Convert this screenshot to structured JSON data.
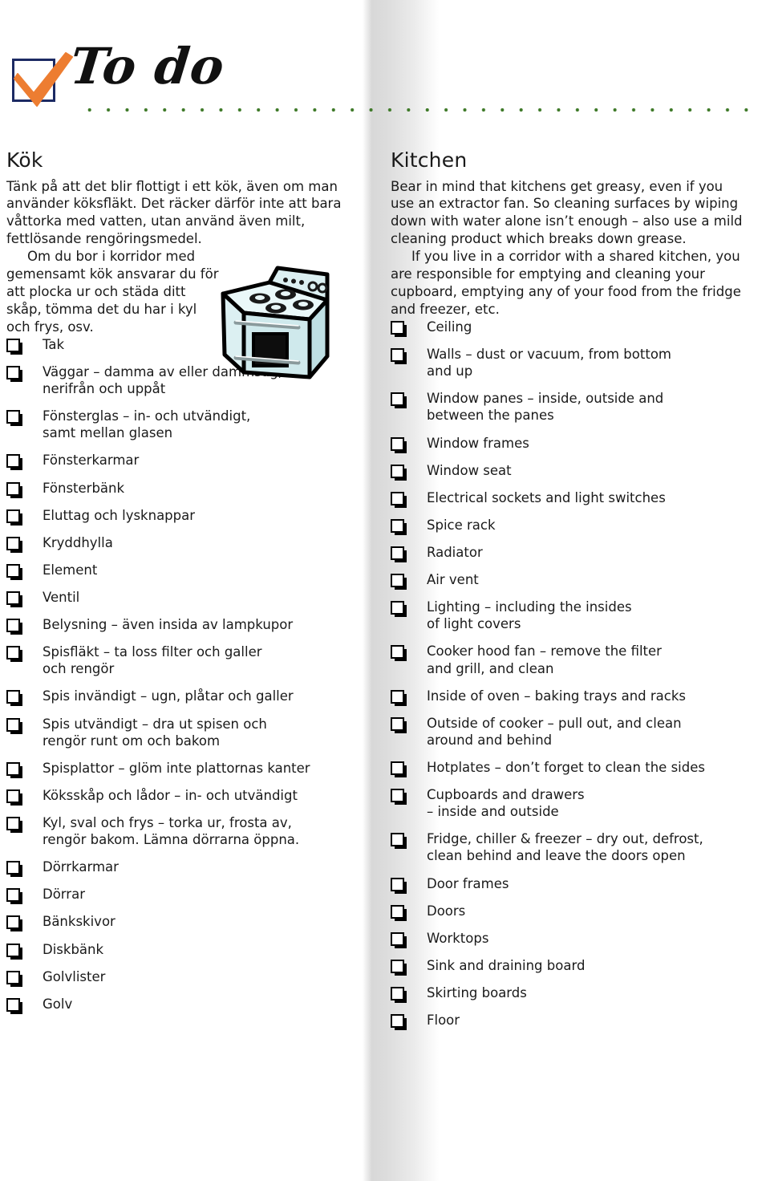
{
  "header": {
    "title": "To do",
    "checkbox_icon": "checkbox-with-checkmark",
    "checkbox_border_color": "#1c2a63",
    "checkmark_color": "#ED7D31",
    "rule_dot_color": "#3f7a29"
  },
  "illustration": {
    "name": "stove-cooker-illustration",
    "body_color": "#d6eef0",
    "outline_color": "#000000"
  },
  "swedish": {
    "title": "Kök",
    "intro_part1": "Tänk på att det blir flottigt i ett kök, även om man använder köksfläkt. Det räcker därför inte att bara våttorka med vatten, utan använd även milt, fettlösande rengöringsmedel.",
    "intro_part2": "Om du bor i korridor med gemensamt kök ansvarar du för att plocka ur och städa ditt skåp, tömma det du har i kyl och frys, osv.",
    "items": [
      "Tak",
      "Väggar – damma av eller dammsug,\nnerifrån och uppåt",
      "Fönsterglas – in- och utvändigt,\nsamt mellan glasen",
      "Fönsterkarmar",
      "Fönsterbänk",
      "Eluttag och lysknappar",
      "Kryddhylla",
      "Element",
      "Ventil",
      "Belysning – även insida av lampkupor",
      "Spisfläkt – ta loss filter och galler\noch rengör",
      "Spis invändigt – ugn, plåtar och galler",
      "Spis utvändigt – dra ut spisen och\nrengör runt om och bakom",
      "Spisplattor – glöm inte plattornas kanter",
      "Köksskåp och lådor – in- och utvändigt",
      "Kyl, sval och frys – torka ur, frosta av,\nrengör bakom. Lämna dörrarna öppna.",
      "Dörrkarmar",
      "Dörrar",
      "Bänkskivor",
      "Diskbänk",
      "Golvlister",
      "Golv"
    ]
  },
  "english": {
    "title": "Kitchen",
    "intro_part1": "Bear in mind that kitchens get greasy, even if you use an extractor fan. So cleaning surfaces by wiping down with water alone isn’t enough – also use a mild cleaning product which breaks down grease.",
    "intro_part2": "If you live in a corridor with a shared kitchen, you are responsible for emptying and cleaning your cupboard, emptying any of your food from the fridge and freezer, etc.",
    "items": [
      "Ceiling",
      "Walls – dust or vacuum, from bottom\nand up",
      "Window panes – inside, outside and\nbetween the panes",
      "Window frames",
      "Window seat",
      "Electrical sockets and light switches",
      "Spice rack",
      "Radiator",
      "Air vent",
      "Lighting – including the insides\nof light covers",
      "Cooker hood fan – remove the filter\nand grill, and clean",
      "Inside of oven – baking trays and racks",
      "Outside of cooker – pull out, and clean\naround and behind",
      "Hotplates – don’t forget to clean the sides",
      "Cupboards and drawers\n– inside and outside",
      "Fridge, chiller & freezer – dry out, defrost,\nclean behind and leave the doors open",
      "Door frames",
      "Doors",
      "Worktops",
      "Sink and draining board",
      "Skirting boards",
      "Floor"
    ]
  }
}
